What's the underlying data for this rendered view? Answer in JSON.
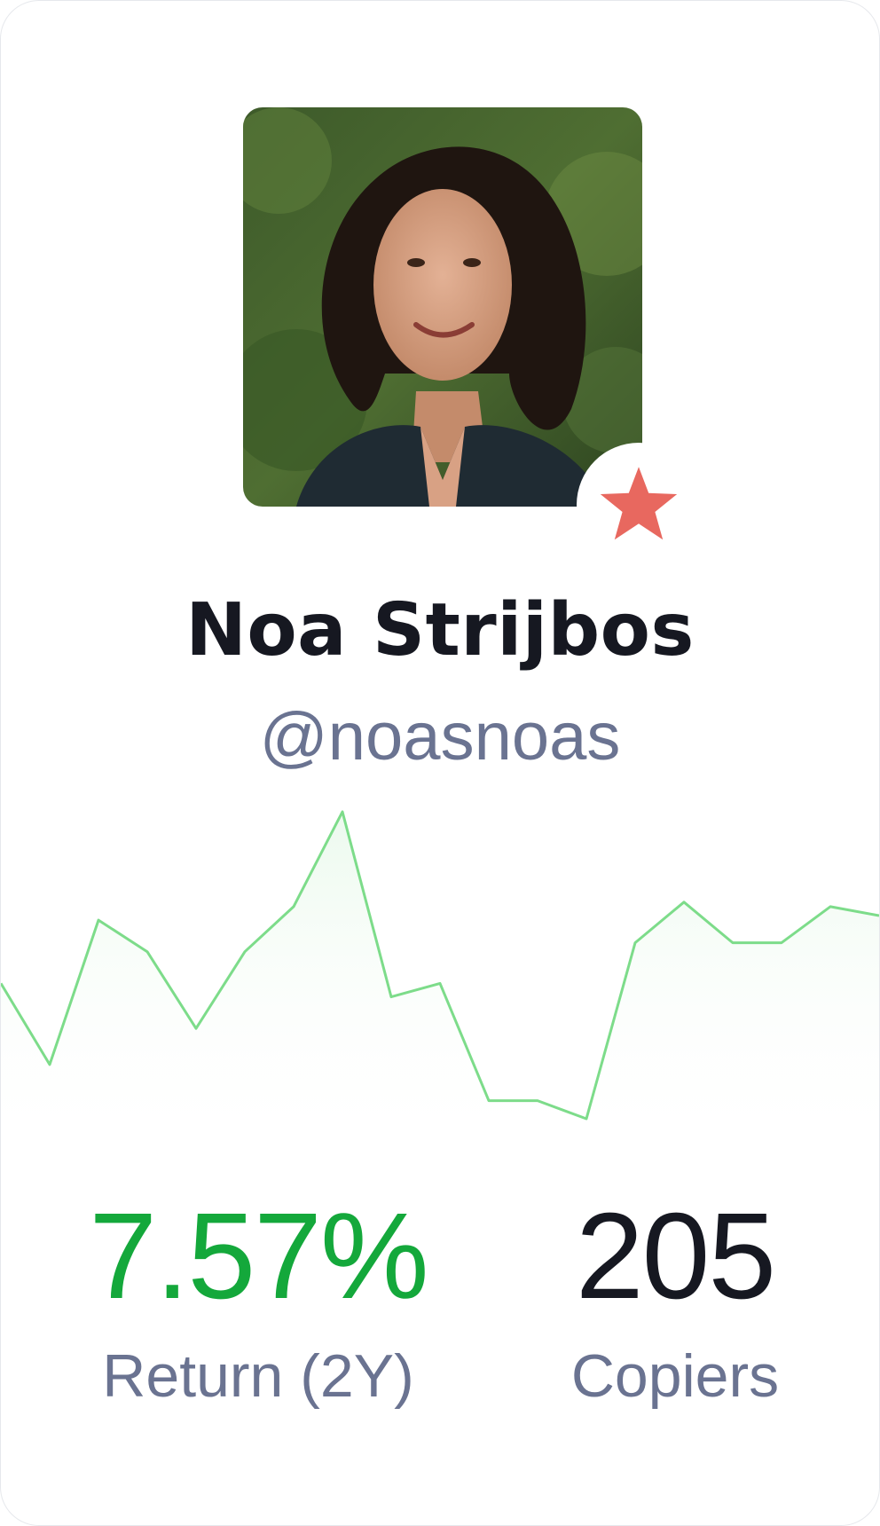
{
  "profile": {
    "name": "Noa Strijbos",
    "handle": "@noasnoas",
    "avatar": "avatar-photo",
    "badge_icon": "star-icon",
    "badge_color": "#e8685f"
  },
  "stats": {
    "return_value": "7.57%",
    "return_label": "Return (2Y)",
    "copiers_value": "205",
    "copiers_label": "Copiers"
  },
  "colors": {
    "positive": "#14a83b",
    "sparkline": "#7ddc8a",
    "muted": "#6a7391"
  },
  "chart_data": {
    "type": "line",
    "values": [
      62,
      44,
      76,
      69,
      52,
      69,
      79,
      100,
      59,
      62,
      36,
      36,
      32,
      71,
      80,
      71,
      71,
      79,
      77
    ]
  }
}
